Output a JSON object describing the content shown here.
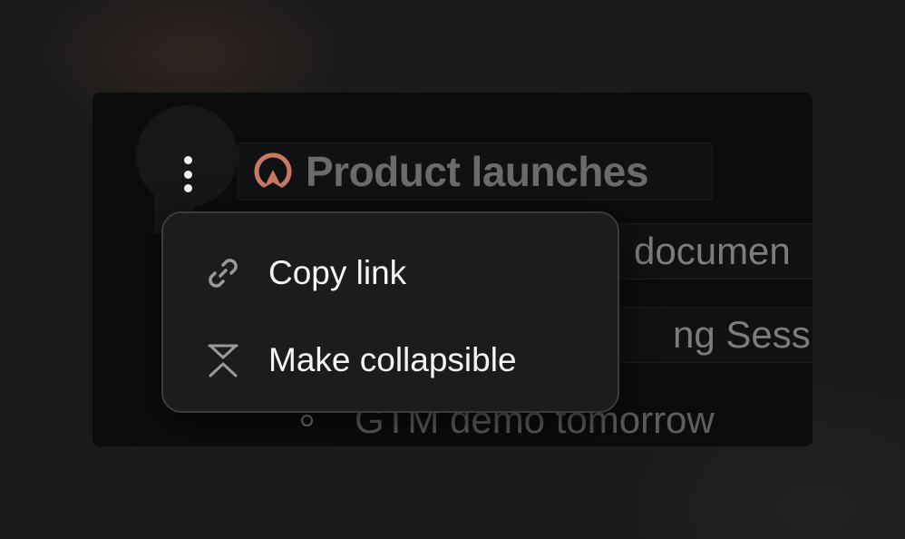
{
  "block": {
    "heading": "Product launches",
    "heading_icon": "rocket-launch-icon",
    "rows": [
      {
        "text": "documen"
      },
      {
        "text": "ng Session"
      },
      {
        "text": "GTM demo tomorrow"
      }
    ]
  },
  "context_menu": {
    "items": [
      {
        "label": "Copy link",
        "icon": "link-icon"
      },
      {
        "label": "Make collapsible",
        "icon": "collapse-icon"
      }
    ]
  },
  "colors": {
    "accent_icon": "#c97862",
    "menu_bg": "#1c1c1c",
    "panel_bg": "#0b0c0c"
  }
}
